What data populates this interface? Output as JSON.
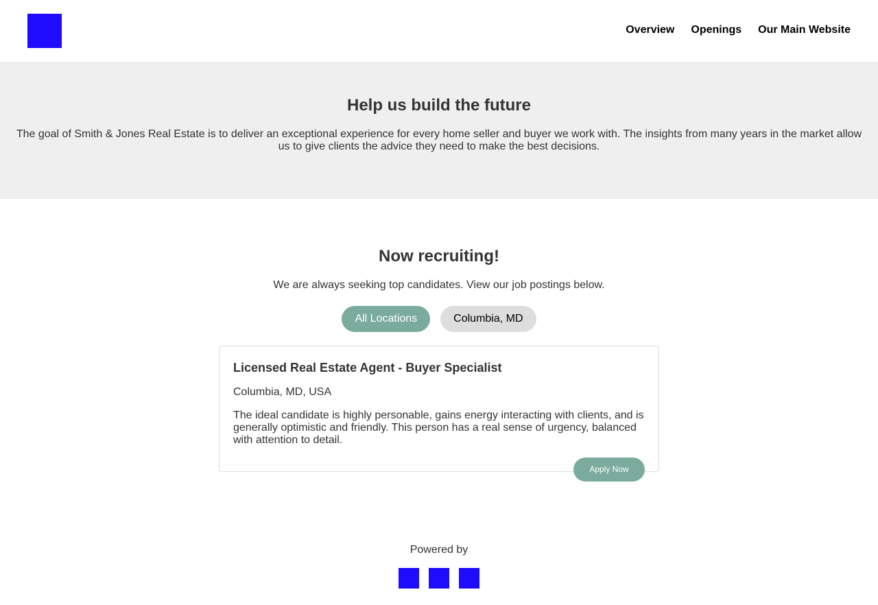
{
  "header": {
    "logo_color": "#1d0cff",
    "nav": [
      "Overview",
      "Openings",
      "Our Main Website"
    ]
  },
  "hero": {
    "title": "Help us build the future",
    "text": "The goal of Smith & Jones Real Estate is to deliver an exceptional experience for every home seller and buyer we work with. The insights from many years in the market allow us to give clients the advice they need to make the best decisions."
  },
  "recruit": {
    "title": "Now recruiting!",
    "lead": "We are always seeking top candidates. View our job postings below.",
    "filters": [
      "All Locations",
      "Columbia, MD"
    ],
    "active_filter": "All Locations"
  },
  "job": {
    "title": "Licensed Real Estate Agent - Buyer Specialist",
    "location": "Columbia, MD, USA",
    "description": "The ideal candidate is highly personable, gains energy interacting with clients, and is generally optimistic and friendly. This person has a real sense of urgency, balanced with attention to detail.",
    "apply_label": "Apply Now"
  },
  "footer": {
    "powered_by": "Powered by",
    "icon_count": 3
  },
  "colors": {
    "accent": "#7aab9c",
    "placeholder": "#1d0cff",
    "hero_bg": "#efefef"
  }
}
